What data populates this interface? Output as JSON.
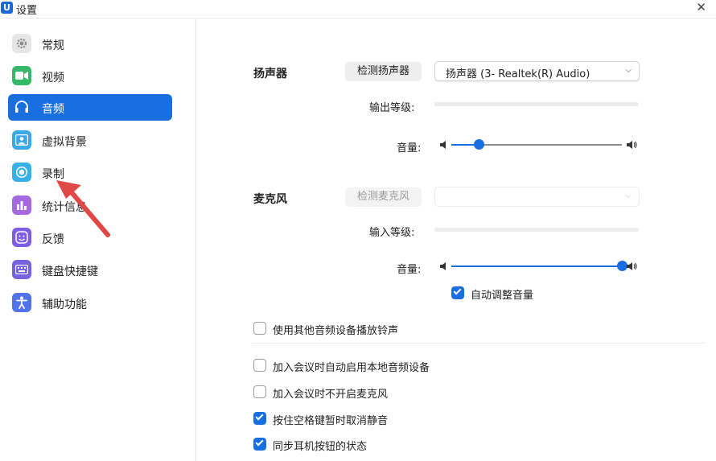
{
  "window": {
    "title": "设置",
    "logo_text": "U"
  },
  "sidebar": {
    "items": [
      {
        "label": "常规",
        "icon": "gear-icon",
        "color": "#e6e6e6"
      },
      {
        "label": "视频",
        "icon": "video-icon",
        "color": "#36b86a"
      },
      {
        "label": "音频",
        "icon": "headphones-icon",
        "color": "#1a6fe0",
        "active": true
      },
      {
        "label": "虚拟背景",
        "icon": "virtual-background-icon",
        "color": "#3aa9e6"
      },
      {
        "label": "录制",
        "icon": "record-icon",
        "color": "#36b2e6"
      },
      {
        "label": "统计信息",
        "icon": "statistics-icon",
        "color": "#a56adf"
      },
      {
        "label": "反馈",
        "icon": "feedback-icon",
        "color": "#7e5ce6"
      },
      {
        "label": "键盘快捷键",
        "icon": "keyboard-icon",
        "color": "#7563e0"
      },
      {
        "label": "辅助功能",
        "icon": "accessibility-icon",
        "color": "#5272e8"
      }
    ]
  },
  "speaker": {
    "label": "扬声器",
    "test_button": "检测扬声器",
    "device": "扬声器 (3- Realtek(R) Audio)",
    "output_level_label": "输出等级:",
    "volume_label": "音量:",
    "volume": 0.16
  },
  "microphone": {
    "label": "麦克风",
    "test_button": "检测麦克风",
    "device": "",
    "input_level_label": "输入等级:",
    "volume_label": "音量:",
    "volume": 1.0,
    "auto_adjust_label": "自动调整音量",
    "auto_adjust": true
  },
  "options": [
    {
      "label": "使用其他音频设备播放铃声",
      "checked": false
    },
    {
      "label": "加入会议时自动启用本地音频设备",
      "checked": false
    },
    {
      "label": "加入会议时不开启麦克风",
      "checked": false
    },
    {
      "label": "按住空格键暂时取消静音",
      "checked": true
    },
    {
      "label": "同步耳机按钮的状态",
      "checked": true
    }
  ],
  "annotation": {
    "arrow_color": "#e04848"
  }
}
